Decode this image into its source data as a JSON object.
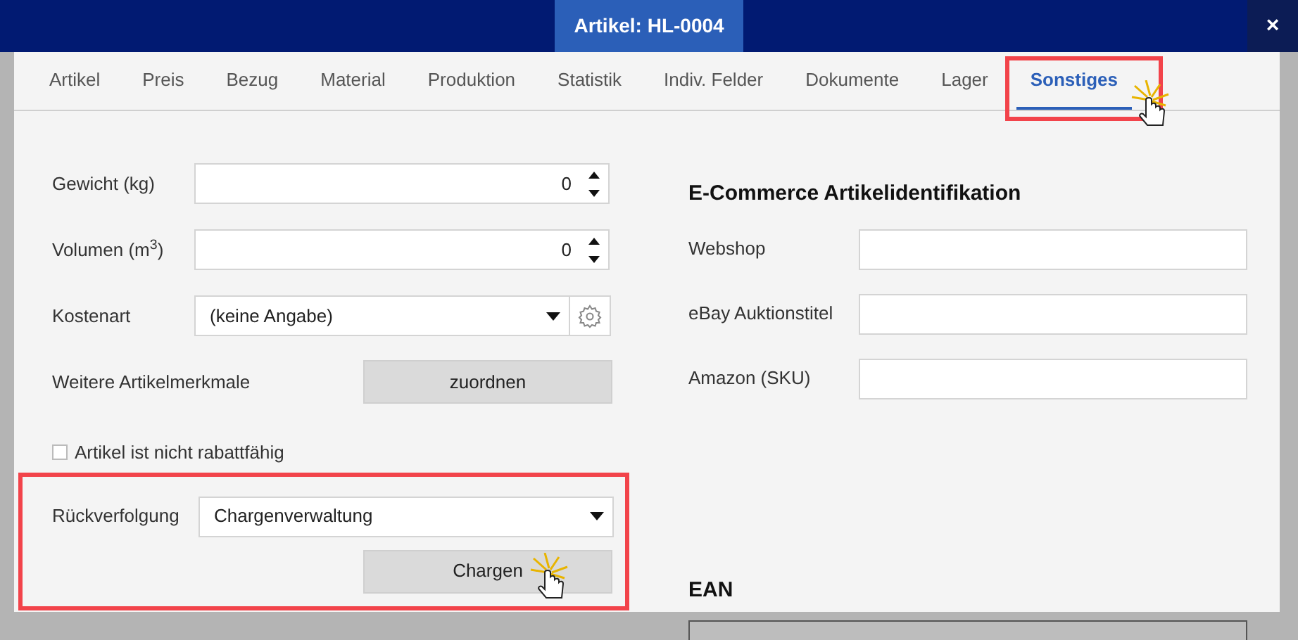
{
  "window": {
    "title": "Artikel: HL-0004",
    "close": "×"
  },
  "tabs": [
    {
      "label": "Artikel",
      "selected": false,
      "annotated": false
    },
    {
      "label": "Preis",
      "selected": false,
      "annotated": false
    },
    {
      "label": "Bezug",
      "selected": false,
      "annotated": false
    },
    {
      "label": "Material",
      "selected": false,
      "annotated": false
    },
    {
      "label": "Produktion",
      "selected": false,
      "annotated": false
    },
    {
      "label": "Statistik",
      "selected": false,
      "annotated": false
    },
    {
      "label": "Indiv. Felder",
      "selected": false,
      "annotated": false
    },
    {
      "label": "Dokumente",
      "selected": false,
      "annotated": false
    },
    {
      "label": "Lager",
      "selected": false,
      "annotated": false
    },
    {
      "label": "Sonstiges",
      "selected": true,
      "annotated": true
    }
  ],
  "left_rows": [
    {
      "kind": "number",
      "label": "Gewicht (kg)",
      "value": "0"
    },
    {
      "kind": "number",
      "label": "Volumen (m$^{3}$)",
      "value": "0"
    },
    {
      "kind": "select",
      "label": "Kostenart",
      "value": "(keine Angabe)",
      "settings": true
    },
    {
      "kind": "button",
      "label": "Weitere Artikelmerkmale",
      "button": "zuordnen"
    }
  ],
  "checkbox": {
    "label": "Artikel ist nicht rabattfähig",
    "checked": false
  },
  "tracking": {
    "label": "Rückverfolgung",
    "value": "Chargenverwaltung",
    "button": "Chargen",
    "annotated": true
  },
  "ecommerce": {
    "title": "E-Commerce Artikelidentifikation",
    "fields": [
      {
        "label": "Webshop"
      },
      {
        "label": "eBay Auktionstitel"
      },
      {
        "label": "Amazon (SKU)"
      }
    ]
  },
  "ean": {
    "title": "EAN"
  }
}
